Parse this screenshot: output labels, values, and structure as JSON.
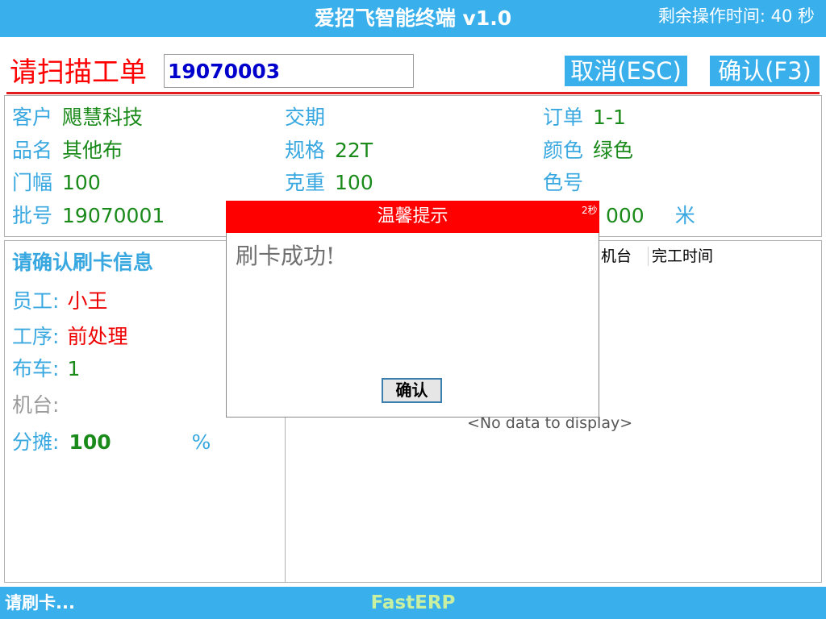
{
  "title_bar": {
    "title": "爱招飞智能终端 v1.0",
    "remaining_time": "剩余操作时间: 40 秒"
  },
  "scan": {
    "label": "请扫描工单",
    "value": "19070003",
    "cancel_label": "取消(ESC)",
    "confirm_label": "确认(F3)"
  },
  "order_info": {
    "customer_label": "客户",
    "customer": "飓慧科技",
    "delivery_label": "交期",
    "delivery": "",
    "order_label": "订单",
    "order": "1-1",
    "product_label": "品名",
    "product": "其他布",
    "spec_label": "规格",
    "spec": "22T",
    "color_label": "颜色",
    "color": "绿色",
    "width_label": "门幅",
    "width": "100",
    "weight_label": "克重",
    "weight": "100",
    "color_no_label": "色号",
    "color_no": "",
    "batch_label": "批号",
    "batch": "19070001",
    "qty_value": "000",
    "qty_unit": "米"
  },
  "card_info": {
    "heading": "请确认刷卡信息",
    "employee_label": "员工:",
    "employee": "小王",
    "process_label": "工序:",
    "process": "前处理",
    "cart_label": "布车:",
    "cart": "1",
    "machine_label": "机台:",
    "machine": "",
    "share_label": "分摊:",
    "share": "100",
    "share_unit": "%"
  },
  "grid": {
    "columns": [
      "机台",
      "完工时间"
    ],
    "empty_text": "<No data to display>"
  },
  "dialog": {
    "title": "温馨提示",
    "countdown": "2秒",
    "message": "刷卡成功!",
    "button_label": "确认"
  },
  "status_bar": {
    "status": "请刷卡...",
    "brand": "FastERP"
  },
  "colors": {
    "accent": "#39b0ec",
    "danger": "#ff0000",
    "value_green": "#1a8a1a"
  }
}
